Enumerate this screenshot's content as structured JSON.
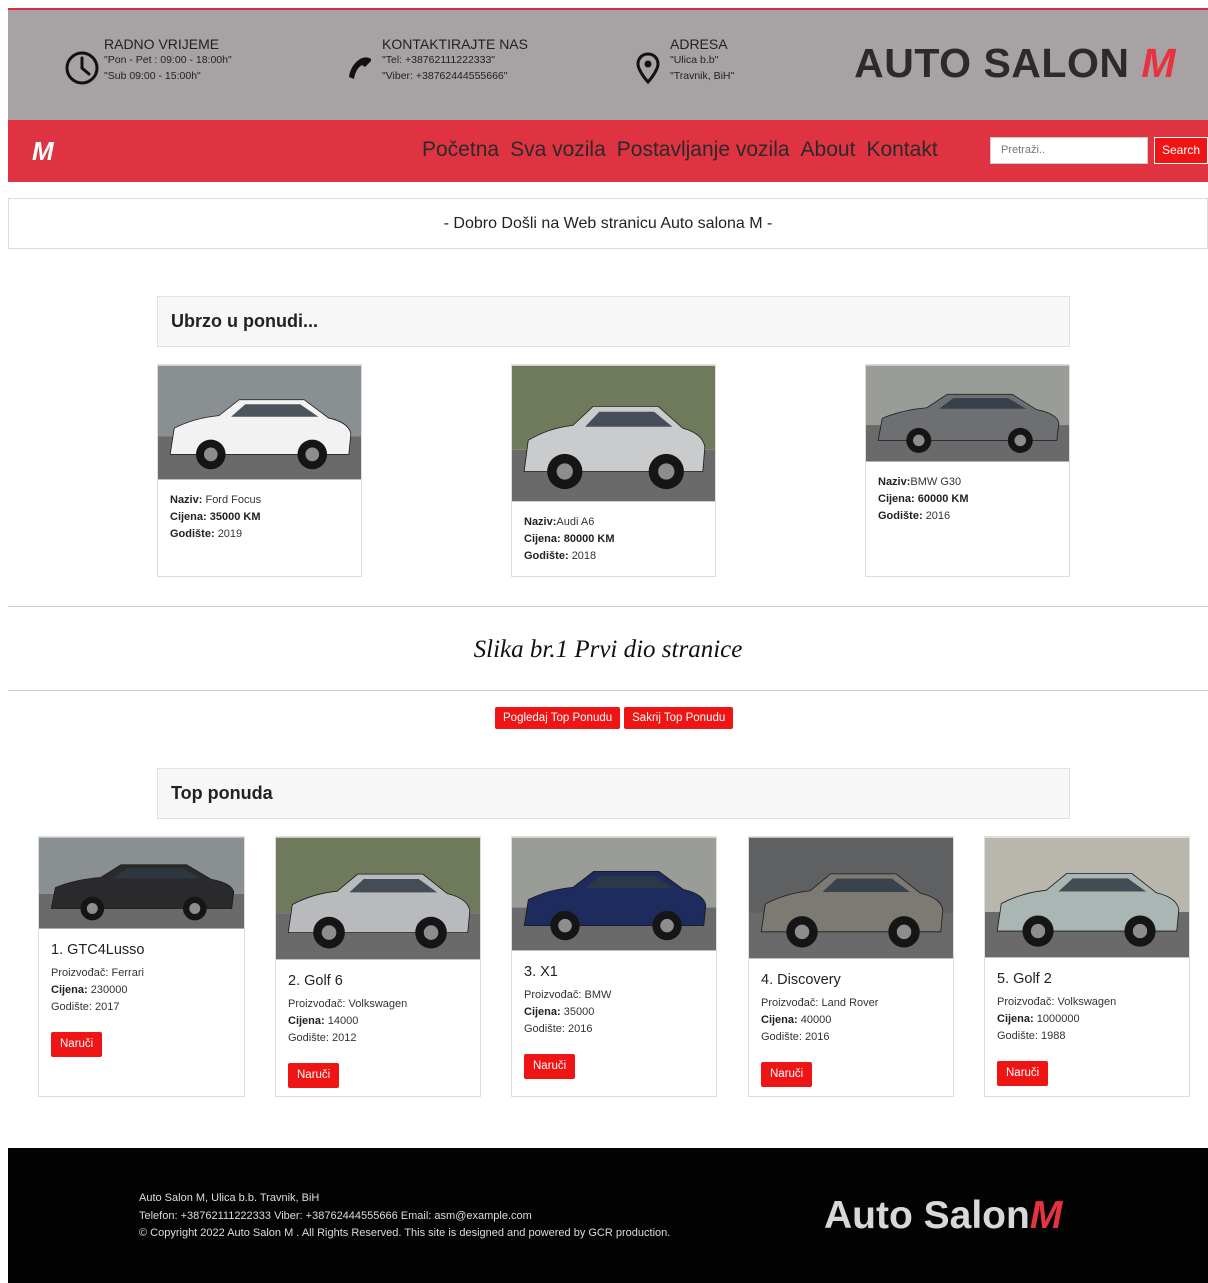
{
  "header": {
    "hours": {
      "title": "RADNO VRIJEME",
      "line1": "\"Pon - Pet : 09:00 - 18:00h\"",
      "line2": "\"Sub 09:00 - 15:00h\"",
      "icon": "clock-icon"
    },
    "contact": {
      "title": "KONTAKTIRAJTE NAS",
      "line1": "\"Tel: +38762111222333\"",
      "line2": "\"Viber: +38762444555666\"",
      "icon": "phone-icon"
    },
    "address": {
      "title": "ADRESA",
      "line1": "\"Ulica b.b\"",
      "line2": "\"Travnik, BiH\"",
      "icon": "location-pin-icon"
    },
    "brand_main": "AUTO SALON ",
    "brand_m": "M"
  },
  "nav": {
    "logo": "M",
    "links": [
      "Početna",
      "Sva vozila",
      "Postavljanje vozila",
      "About",
      "Kontakt"
    ],
    "search_placeholder": "Pretraži..",
    "search_label": "Search"
  },
  "welcome": "- Dobro Došli na Web stranicu Auto salona M -",
  "upcoming": {
    "title": "Ubrzo u ponudi...",
    "labels": {
      "name": "Naziv:",
      "price": "Cijena:",
      "year": "Godište:"
    },
    "cars": [
      {
        "name": "Ford Focus",
        "price": "35000 KM",
        "year": "2019",
        "color": "#f2f2f2"
      },
      {
        "name": "Audi A6",
        "price": "80000 KM",
        "year": "2018",
        "color": "#c9cbcd"
      },
      {
        "name": "BMW G30",
        "price": "60000 KM",
        "year": "2016",
        "color": "#6d6f72"
      }
    ]
  },
  "caption": "Slika br.1 Prvi dio stranice",
  "toggle": {
    "show": "Pogledaj Top Ponudu",
    "hide": "Sakrij Top Ponudu"
  },
  "top_offer": {
    "title": "Top ponuda",
    "labels": {
      "maker": "Proizvođač:",
      "price": "Cijena:",
      "year": "Godište:",
      "order": "Naruči"
    },
    "cars": [
      {
        "name": "1. GTC4Lusso",
        "maker": "Ferrari",
        "price": "230000",
        "year": "2017",
        "color": "#2a2a2c"
      },
      {
        "name": "2. Golf 6",
        "maker": "Volkswagen",
        "price": "14000",
        "year": "2012",
        "color": "#b8babd"
      },
      {
        "name": "3. X1",
        "maker": "BMW",
        "price": "35000",
        "year": "2016",
        "color": "#1d2b5e"
      },
      {
        "name": "4. Discovery",
        "maker": "Land Rover",
        "price": "40000",
        "year": "2016",
        "color": "#7c7a72"
      },
      {
        "name": "5. Golf 2",
        "maker": "Volkswagen",
        "price": "1000000",
        "year": "1988",
        "color": "#a9b6b4"
      }
    ]
  },
  "footer": {
    "line1": "Auto Salon M, Ulica b.b. Travnik, BiH",
    "line2": "Telefon: +38762111222333 Viber: +38762444555666 Email: asm@example.com",
    "line3": "© Copyright 2022 Auto Salon M . All Rights Reserved. This site is designed and powered by GCR production.",
    "brand_main": "Auto Salon",
    "brand_m": "M"
  }
}
